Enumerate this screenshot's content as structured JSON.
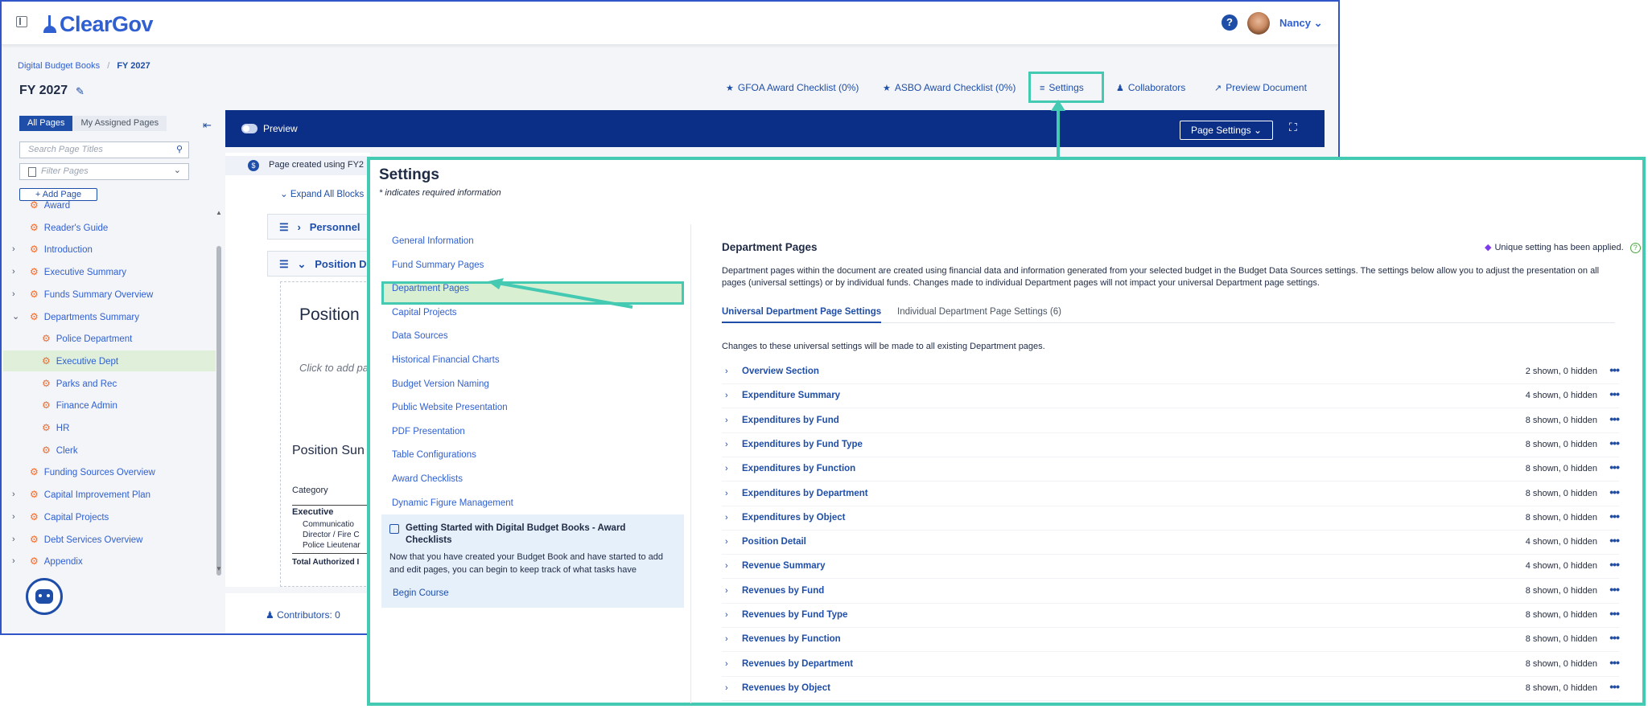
{
  "app": {
    "logo": "ClearGov",
    "user": "Nancy",
    "help": "?"
  },
  "breadcrumb": {
    "root": "Digital Budget Books",
    "sep": "/",
    "current": "FY 2027"
  },
  "page_title": "FY 2027",
  "top_links": [
    {
      "label": "GFOA Award Checklist (0%)",
      "icon": "star-icon"
    },
    {
      "label": "ASBO Award Checklist (0%)",
      "icon": "star-icon"
    },
    {
      "label": "Settings",
      "icon": "sliders-icon"
    },
    {
      "label": "Collaborators",
      "icon": "people-icon"
    },
    {
      "label": "Preview Document",
      "icon": "external-link-icon"
    }
  ],
  "left": {
    "tabs": [
      "All Pages",
      "My Assigned Pages"
    ],
    "search_placeholder": "Search Page Titles",
    "filter_placeholder": "Filter Pages",
    "add_page": "+ Add Page",
    "tree": [
      {
        "label": "Award",
        "level": 0,
        "caret": ""
      },
      {
        "label": "Reader's Guide",
        "level": 0,
        "caret": ""
      },
      {
        "label": "Introduction",
        "level": 0,
        "caret": ">"
      },
      {
        "label": "Executive Summary",
        "level": 0,
        "caret": ">"
      },
      {
        "label": "Funds Summary Overview",
        "level": 0,
        "caret": ">"
      },
      {
        "label": "Departments Summary",
        "level": 0,
        "caret": "v"
      },
      {
        "label": "Police Department",
        "level": 1,
        "caret": ""
      },
      {
        "label": "Executive Dept",
        "level": 1,
        "caret": "",
        "selected": true
      },
      {
        "label": "Parks and Rec",
        "level": 1,
        "caret": ""
      },
      {
        "label": "Finance Admin",
        "level": 1,
        "caret": ""
      },
      {
        "label": "HR",
        "level": 1,
        "caret": ""
      },
      {
        "label": "Clerk",
        "level": 1,
        "caret": ""
      },
      {
        "label": "Funding Sources Overview",
        "level": 0,
        "caret": ""
      },
      {
        "label": "Capital Improvement Plan",
        "level": 0,
        "caret": ">"
      },
      {
        "label": "Capital Projects",
        "level": 0,
        "caret": ">"
      },
      {
        "label": "Debt Services Overview",
        "level": 0,
        "caret": ">"
      },
      {
        "label": "Appendix",
        "level": 0,
        "caret": ">"
      }
    ]
  },
  "editor": {
    "preview_label": "Preview",
    "page_settings": "Page Settings",
    "created_text": "Page created using FY2",
    "expand_all": "Expand All Blocks",
    "block1": "Personnel",
    "block2": "Position D",
    "position_title": "Position",
    "click_add": "Click to add pa",
    "position_summary": "Position Sun",
    "category_header": "Category",
    "rows": [
      "Executive",
      "Communicatio",
      "Director / Fire C",
      "Police Lieutenar",
      "Total Authorized I"
    ],
    "contributors": "Contributors: 0"
  },
  "modal": {
    "title": "Settings",
    "required_note": "* indicates required information",
    "menu": [
      "General Information",
      "Fund Summary Pages",
      "Department Pages",
      "Capital Projects",
      "Data Sources",
      "Historical Financial Charts",
      "Budget Version Naming",
      "Public Website Presentation",
      "PDF Presentation",
      "Table Configurations",
      "Award Checklists",
      "Dynamic Figure Management"
    ],
    "course": {
      "title": "Getting Started with Digital Budget Books - Award Checklists",
      "text": "Now that you have created your Budget Book and have started to add and edit pages, you can begin to keep track of what tasks have",
      "link": "Begin Course"
    },
    "section_title": "Department Pages",
    "unique_note": "Unique setting has been applied.",
    "description": "Department pages within the document are created using financial data and information generated from your selected budget in the Budget Data Sources settings. The settings below allow you to adjust the presentation on all pages (universal settings) or by individual funds. Changes made to individual Department pages will not impact your universal Department page settings.",
    "tabs": [
      "Universal Department Page Settings",
      "Individual Department Page Settings (6)"
    ],
    "note": "Changes to these universal settings will be made to all existing Department pages.",
    "settings_rows": [
      {
        "label": "Overview Section",
        "count": "2 shown, 0 hidden"
      },
      {
        "label": "Expenditure Summary",
        "count": "4 shown, 0 hidden"
      },
      {
        "label": "Expenditures by Fund",
        "count": "8 shown, 0 hidden"
      },
      {
        "label": "Expenditures by Fund Type",
        "count": "8 shown, 0 hidden"
      },
      {
        "label": "Expenditures by Function",
        "count": "8 shown, 0 hidden"
      },
      {
        "label": "Expenditures by Department",
        "count": "8 shown, 0 hidden"
      },
      {
        "label": "Expenditures by Object",
        "count": "8 shown, 0 hidden"
      },
      {
        "label": "Position Detail",
        "count": "4 shown, 0 hidden"
      },
      {
        "label": "Revenue Summary",
        "count": "4 shown, 0 hidden"
      },
      {
        "label": "Revenues by Fund",
        "count": "8 shown, 0 hidden"
      },
      {
        "label": "Revenues by Fund Type",
        "count": "8 shown, 0 hidden"
      },
      {
        "label": "Revenues by Function",
        "count": "8 shown, 0 hidden"
      },
      {
        "label": "Revenues by Department",
        "count": "8 shown, 0 hidden"
      },
      {
        "label": "Revenues by Object",
        "count": "8 shown, 0 hidden"
      }
    ]
  },
  "colors": {
    "accent": "#1f4ea8",
    "highlight": "#44c9b3",
    "selected_bg": "#e0efd9",
    "gear": "#f06a2d",
    "preview_bar": "#0b2f86"
  }
}
